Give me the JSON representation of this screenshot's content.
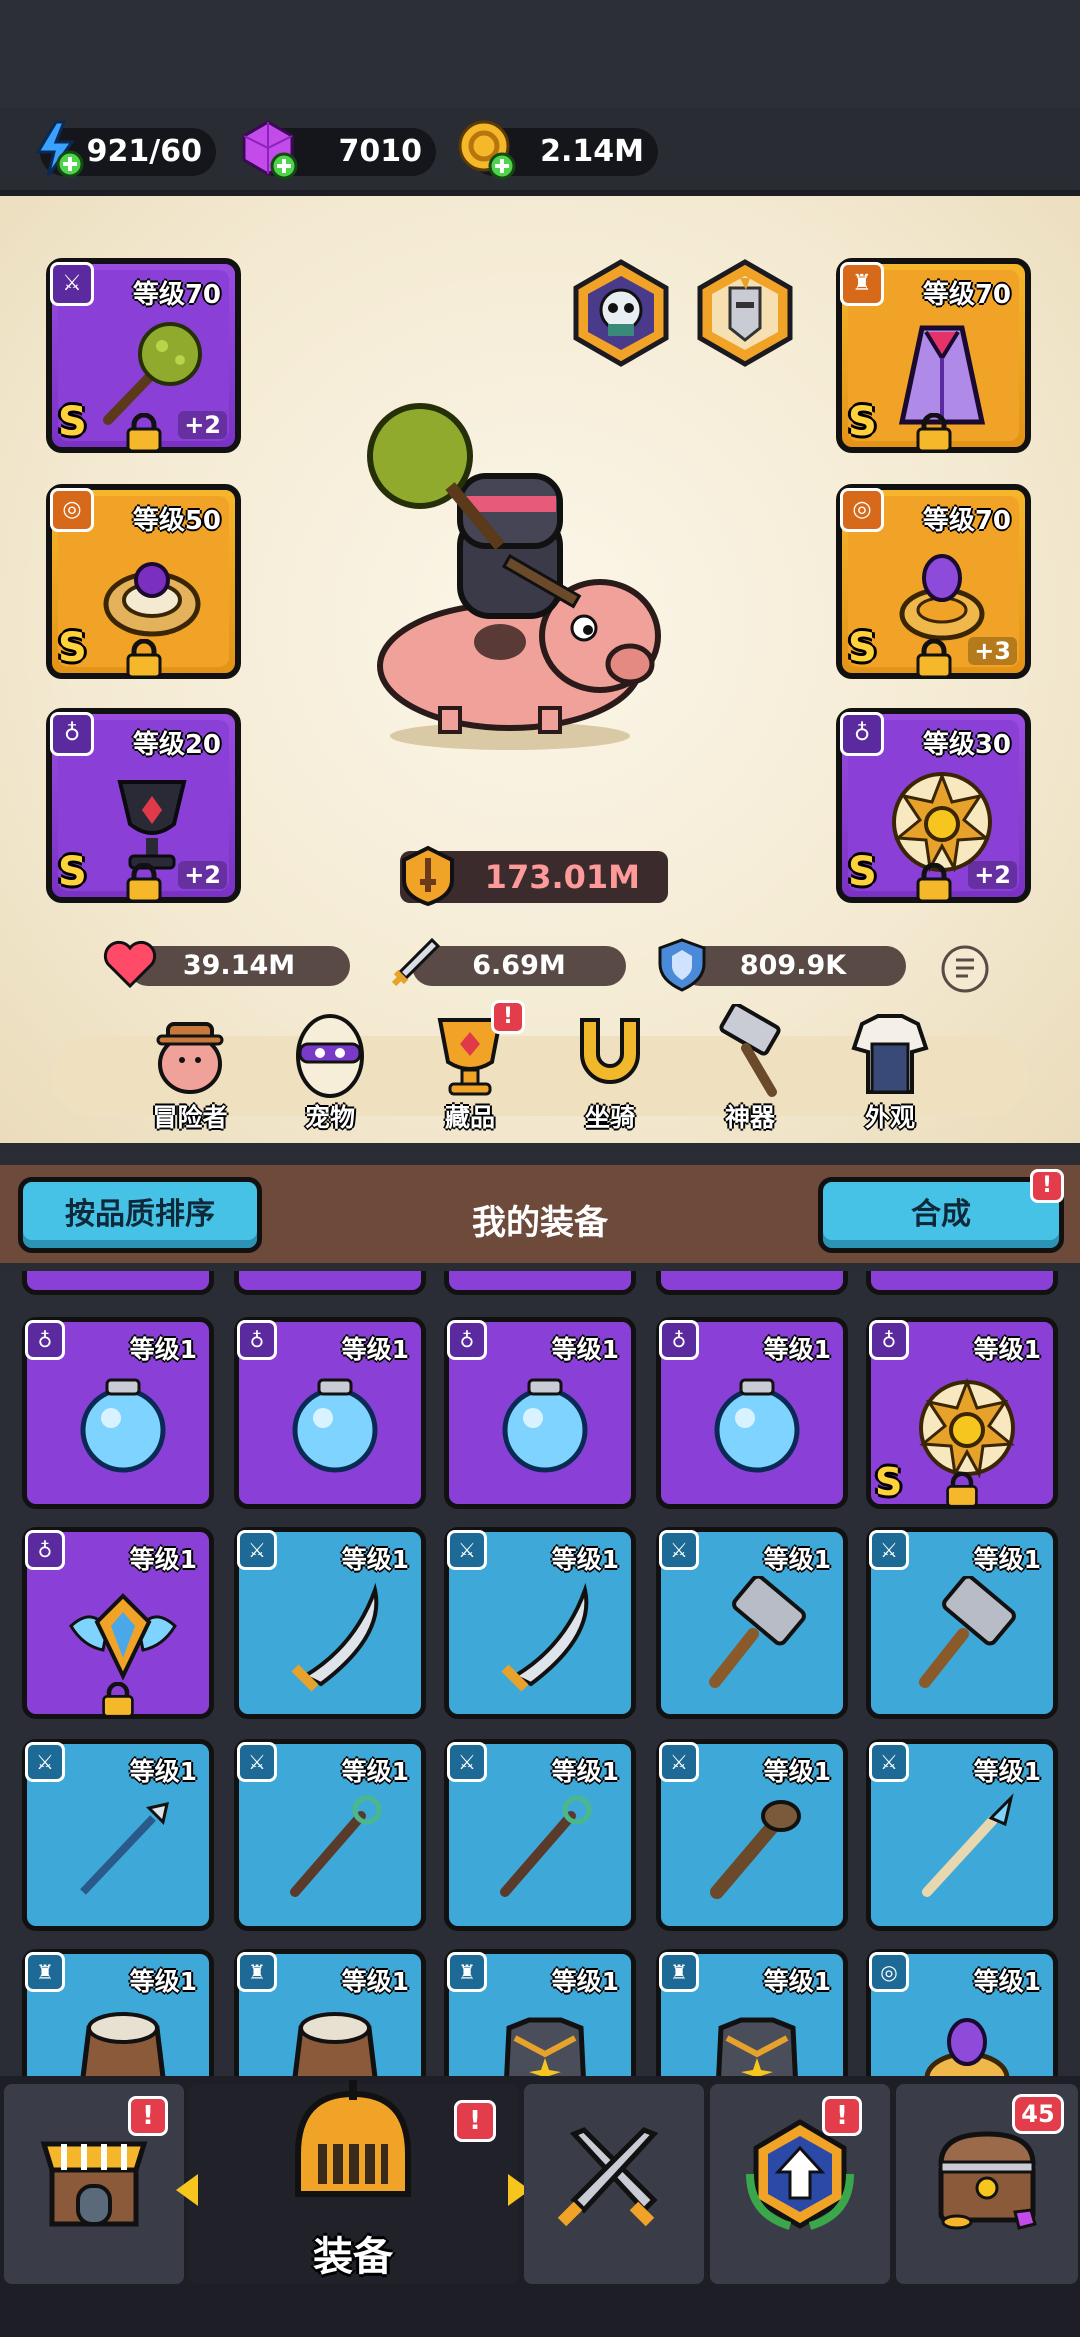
{
  "resources": {
    "energy": "921/60",
    "gems": "7010",
    "gold": "2.14M"
  },
  "equipped_left": [
    {
      "level": "等级70",
      "rank": "S",
      "plus": "+2",
      "icon": "sword-badge"
    },
    {
      "level": "等级50",
      "rank": "S",
      "plus": "",
      "icon": "ring-badge"
    },
    {
      "level": "等级20",
      "rank": "S",
      "plus": "+2",
      "icon": "necklace-badge"
    }
  ],
  "equipped_right": [
    {
      "level": "等级70",
      "rank": "S",
      "plus": "",
      "icon": "armor-badge"
    },
    {
      "level": "等级70",
      "rank": "S",
      "plus": "+3",
      "icon": "ring-badge"
    },
    {
      "level": "等级30",
      "rank": "S",
      "plus": "+2",
      "icon": "necklace-badge"
    }
  ],
  "power": "173.01M",
  "stats": {
    "hp": "39.14M",
    "attack": "6.69M",
    "defense": "809.9K"
  },
  "menu": [
    {
      "label": "冒险者",
      "icon": "adventurer-icon"
    },
    {
      "label": "宠物",
      "icon": "pet-egg-icon"
    },
    {
      "label": "藏品",
      "icon": "collection-icon",
      "alert": "!"
    },
    {
      "label": "坐骑",
      "icon": "mount-horseshoe-icon"
    },
    {
      "label": "神器",
      "icon": "artifact-hammer-icon"
    },
    {
      "label": "外观",
      "icon": "outfit-icon"
    }
  ],
  "inventory": {
    "sort_button": "按品质排序",
    "title": "我的装备",
    "merge_button": "合成",
    "merge_alert": "!",
    "rows": [
      [
        {
          "level": "等级1",
          "quality": "purple",
          "kind": "orb"
        },
        {
          "level": "等级1",
          "quality": "purple",
          "kind": "orb"
        },
        {
          "level": "等级1",
          "quality": "purple",
          "kind": "orb"
        },
        {
          "level": "等级1",
          "quality": "purple",
          "kind": "orb"
        },
        {
          "level": "等级1",
          "quality": "purple",
          "kind": "sun-medal",
          "rank": "S",
          "locked": true
        }
      ],
      [
        {
          "level": "等级1",
          "quality": "purple",
          "kind": "winged-shield",
          "locked": true
        },
        {
          "level": "等级1",
          "quality": "blue",
          "kind": "scimitar"
        },
        {
          "level": "等级1",
          "quality": "blue",
          "kind": "scimitar"
        },
        {
          "level": "等级1",
          "quality": "blue",
          "kind": "hammer"
        },
        {
          "level": "等级1",
          "quality": "blue",
          "kind": "hammer"
        }
      ],
      [
        {
          "level": "等级1",
          "quality": "blue",
          "kind": "spear"
        },
        {
          "level": "等级1",
          "quality": "blue",
          "kind": "staff"
        },
        {
          "level": "等级1",
          "quality": "blue",
          "kind": "staff"
        },
        {
          "level": "等级1",
          "quality": "blue",
          "kind": "club"
        },
        {
          "level": "等级1",
          "quality": "blue",
          "kind": "ice-spear"
        }
      ],
      [
        {
          "level": "等级1",
          "quality": "blue",
          "kind": "fur-armor"
        },
        {
          "level": "等级1",
          "quality": "blue",
          "kind": "fur-armor"
        },
        {
          "level": "等级1",
          "quality": "blue",
          "kind": "plate-armor"
        },
        {
          "level": "等级1",
          "quality": "blue",
          "kind": "plate-armor"
        },
        {
          "level": "等级1",
          "quality": "blue",
          "kind": "ring"
        }
      ]
    ]
  },
  "bottom_nav": {
    "shop_alert": "!",
    "equip_label": "装备",
    "equip_alert": "!",
    "upgrade_alert": "!",
    "chest_count": "45"
  },
  "colors": {
    "purple_item": "#8a40d6",
    "blue_item": "#3ea9d9",
    "gold_item": "#f0a326",
    "alert_red": "#e33c4b",
    "button_cyan": "#45c2e6"
  }
}
